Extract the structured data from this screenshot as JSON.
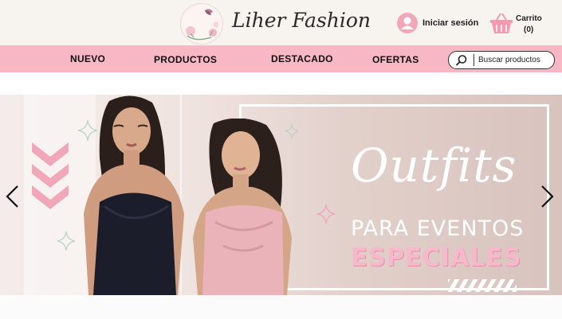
{
  "header": {
    "logo_text": "Liher Fashion",
    "brand_name": "Liher Fashion",
    "login_label": "Iniciar sesión",
    "cart_label": "Carrito",
    "cart_count": "(0)"
  },
  "nav": {
    "items": [
      "NUEVO",
      "PRODUCTOS",
      "DESTACADO",
      "OFERTAS"
    ],
    "search_placeholder": "Buscar productos"
  },
  "banner": {
    "script_text": "Outfits",
    "line1": "PARA EVENTOS",
    "line2": "ESPECIALES"
  },
  "icons": {
    "user": "user-icon",
    "cart": "basket-icon",
    "search": "magnifier-icon",
    "prev": "chevron-left-icon",
    "next": "chevron-right-icon"
  },
  "colors": {
    "nav_bg": "#f7b7c5",
    "accent_pink": "#f2a7b8",
    "banner_pink_text": "#f6b9cb"
  }
}
